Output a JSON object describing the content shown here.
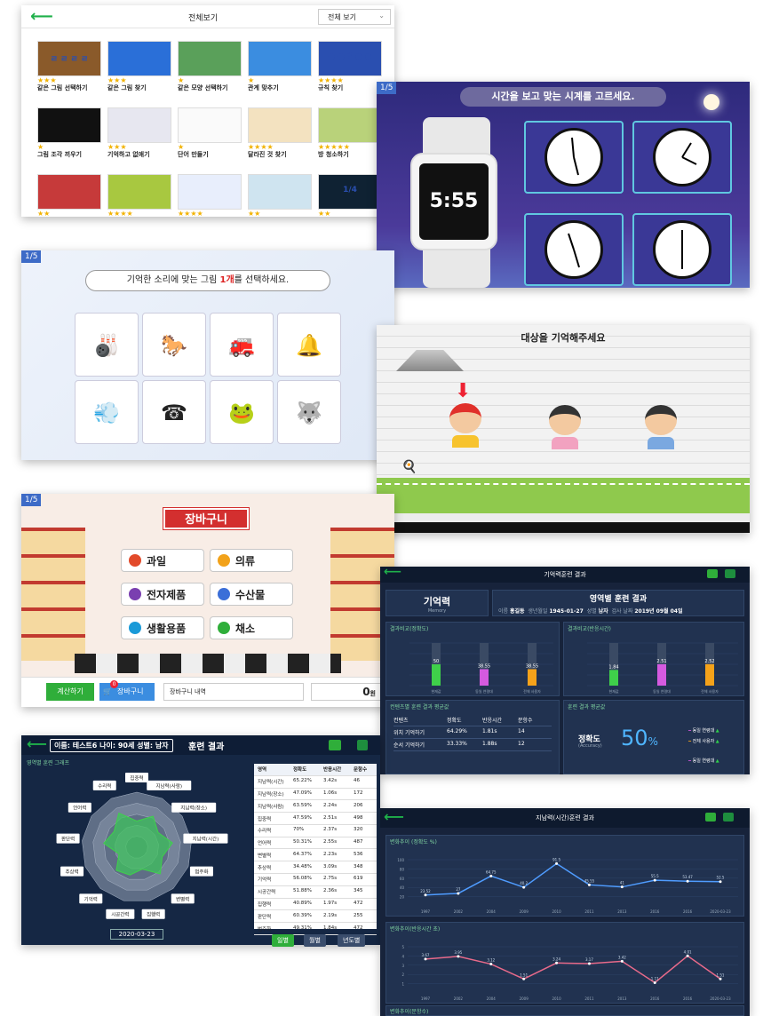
{
  "p1": {
    "title": "전체보기",
    "dropdown": "전체 보기",
    "tiles": [
      {
        "label": "같은 그림 선택하기",
        "stars": "★★★"
      },
      {
        "label": "같은 그림 찾기",
        "stars": "★★★"
      },
      {
        "label": "같은 모양 선택하기",
        "stars": "★"
      },
      {
        "label": "관계 맞추기",
        "stars": "★"
      },
      {
        "label": "규칙 찾기",
        "stars": "★★★★"
      },
      {
        "label": "그림 조각 끼우기",
        "stars": "★"
      },
      {
        "label": "기억하고 없애기",
        "stars": "★★★"
      },
      {
        "label": "단어 만들기",
        "stars": "★"
      },
      {
        "label": "달라진 것 찾기",
        "stars": "★★★★"
      },
      {
        "label": "방 청소하기",
        "stars": "★★★★★"
      },
      {
        "label": "",
        "stars": "★★"
      },
      {
        "label": "",
        "stars": "★★★★"
      },
      {
        "label": "",
        "stars": "★★★★"
      },
      {
        "label": "",
        "stars": "★★"
      },
      {
        "label": "",
        "stars": "★★"
      }
    ],
    "tile_thumb_text": [
      "ㄹ ㄹ ㄹ ㄹ",
      "",
      "",
      "",
      "● ● ? ● ●",
      "",
      "",
      "",
      "",
      "",
      "",
      "",
      "",
      "",
      "1/4"
    ]
  },
  "p2": {
    "counter": "1/5",
    "instruction": "시간을 보고 맞는 시계를 고르세요.",
    "watch_time": "5:55"
  },
  "p3": {
    "counter": "1/5",
    "instruction_pre": "기억한 소리에 맞는 그림 ",
    "instruction_em": "1개",
    "instruction_post": "를 선택하세요.",
    "cards": [
      "🎳",
      "🐎",
      "🚒",
      "🔔",
      "💨",
      "☎",
      "🐸",
      "🐺"
    ]
  },
  "p4": {
    "instruction": "대상을 기억해주세요"
  },
  "p5": {
    "counter": "1/5",
    "title": "장바구니",
    "buttons": [
      "과일",
      "의류",
      "전자제품",
      "수산물",
      "생활용품",
      "채소"
    ],
    "checkout": "계산하기",
    "cart": "장바구니",
    "cart_badge": "0",
    "cart_detail": "장바구니 내역",
    "total": "0",
    "total_unit": "원"
  },
  "p6": {
    "header": "기억력훈련 결과",
    "section": "기억력",
    "section_sub": "Memory",
    "result_title": "영역별 훈련 결과",
    "name_label": "이름",
    "name": "홍길동",
    "birth_label": "생년월일",
    "birth": "1945-01-27",
    "gender_label": "성별",
    "gender": "남자",
    "date_label": "검사 날짜",
    "date": "2019년 09월 04일",
    "chart1_title": "결과비교(정확도)",
    "chart2_title": "결과비교(반응시간)",
    "chart1_values": [
      "50",
      "38.55",
      "38.55"
    ],
    "chart2_values": [
      "1.84",
      "2.51",
      "2.52"
    ],
    "bar_labels": [
      "현재값",
      "동일 연령대",
      "전체 사용자"
    ],
    "table_title": "컨텐츠별 훈련 결과 평균값",
    "avg_title": "훈련 결과 평균값",
    "table_head": [
      "컨텐츠",
      "정확도",
      "반응시간",
      "문항수"
    ],
    "table_rows": [
      [
        "위치 기억하기",
        "64.29%",
        "1.81s",
        "14"
      ],
      [
        "순서 기억하기",
        "33.33%",
        "1.88s",
        "12"
      ]
    ],
    "accuracy_label": "정확도",
    "accuracy_sub": "(Accuracy)",
    "accuracy_value": "50",
    "accuracy_unit": "%",
    "legend": [
      "동일 연령대",
      "전체 사용자",
      "동일 연령대"
    ]
  },
  "p7": {
    "user_info": "이름: 테스트6  나이: 90세  성별: 남자",
    "title": "훈련 결과",
    "chart_title": "영역별 훈련 그래프",
    "radar_labels": [
      "집중력",
      "지남력(사람)",
      "지남력(장소)",
      "지남력(시간)",
      "범주화",
      "변별력",
      "집행력",
      "시공간력",
      "기억력",
      "추상력",
      "판단력",
      "언어력",
      "수리력"
    ],
    "table_head": [
      "영역",
      "정확도",
      "반응시간",
      "문항수"
    ],
    "table_rows": [
      [
        "지남력(시간)",
        "65.22%",
        "3.42s",
        "46"
      ],
      [
        "지남력(장소)",
        "47.09%",
        "1.06s",
        "172"
      ],
      [
        "지남력(사람)",
        "63.59%",
        "2.24s",
        "206"
      ],
      [
        "집중력",
        "47.59%",
        "2.51s",
        "498"
      ],
      [
        "수리력",
        "70%",
        "2.37s",
        "320"
      ],
      [
        "언어력",
        "50.31%",
        "2.55s",
        "487"
      ],
      [
        "변별력",
        "64.37%",
        "2.23s",
        "536"
      ],
      [
        "추상력",
        "34.48%",
        "3.09s",
        "348"
      ],
      [
        "기억력",
        "56.08%",
        "2.75s",
        "619"
      ],
      [
        "시공간력",
        "51.88%",
        "2.36s",
        "345"
      ],
      [
        "집행력",
        "40.89%",
        "1.97s",
        "472"
      ],
      [
        "판단력",
        "60.39%",
        "2.19s",
        "255"
      ],
      [
        "범주화",
        "49.31%",
        "1.84s",
        "472"
      ]
    ],
    "date": "2020-03-23",
    "tabs": [
      "일별",
      "월별",
      "년도별"
    ]
  },
  "p8": {
    "header": "지남력(시간)훈련 결과",
    "chart1_title": "변화추이 (정확도 %)",
    "chart2_title": "변화추이(반응시간 초)",
    "chart3_title": "변화추이(문항수)",
    "x_labels": [
      "1997",
      "2002",
      "2004",
      "2009",
      "2010",
      "2011",
      "2013",
      "2016",
      "2016",
      "2020-03-23"
    ],
    "y1_ticks": [
      "100",
      "80",
      "60",
      "40",
      "20"
    ],
    "y2_ticks": [
      "5",
      "4",
      "3",
      "2",
      "1"
    ],
    "acc_values": [
      "23.52",
      "27",
      "64.75",
      "40.2",
      "91.5",
      "45.55",
      "41",
      "55.5",
      "53.47",
      "52.5"
    ],
    "rt_values": [
      "3.67",
      "3.95",
      "3.12",
      "1.51",
      "3.24",
      "3.17",
      "3.42",
      "1.11",
      "4.01",
      "1.51"
    ]
  },
  "chart_data": [
    {
      "type": "line",
      "title": "변화추이 (정확도 %)",
      "x": [
        "1997",
        "2002",
        "2004",
        "2009",
        "2010",
        "2011",
        "2013",
        "2016",
        "2016",
        "2020-03-23"
      ],
      "series": [
        {
          "values": [
            23.52,
            27,
            64.75,
            40.2,
            91.5,
            45.55,
            41,
            55.5,
            53.47,
            52.5
          ]
        }
      ],
      "ylim": [
        0,
        100
      ]
    },
    {
      "type": "line",
      "title": "변화추이(반응시간 초)",
      "x": [
        "1997",
        "2002",
        "2004",
        "2009",
        "2010",
        "2011",
        "2013",
        "2016",
        "2016",
        "2020-03-23"
      ],
      "series": [
        {
          "values": [
            3.67,
            3.95,
            3.12,
            1.51,
            3.24,
            3.17,
            3.42,
            1.11,
            4.01,
            1.51
          ]
        }
      ],
      "ylim": [
        0,
        5
      ]
    },
    {
      "type": "bar",
      "title": "결과비교(정확도)",
      "categories": [
        "현재값",
        "동일 연령대",
        "전체 사용자"
      ],
      "values": [
        50,
        38.55,
        38.55
      ],
      "ylim": [
        0,
        100
      ]
    },
    {
      "type": "bar",
      "title": "결과비교(반응시간)",
      "categories": [
        "현재값",
        "동일 연령대",
        "전체 사용자"
      ],
      "values": [
        1.84,
        2.51,
        2.52
      ],
      "ylim": [
        0,
        5
      ]
    }
  ]
}
